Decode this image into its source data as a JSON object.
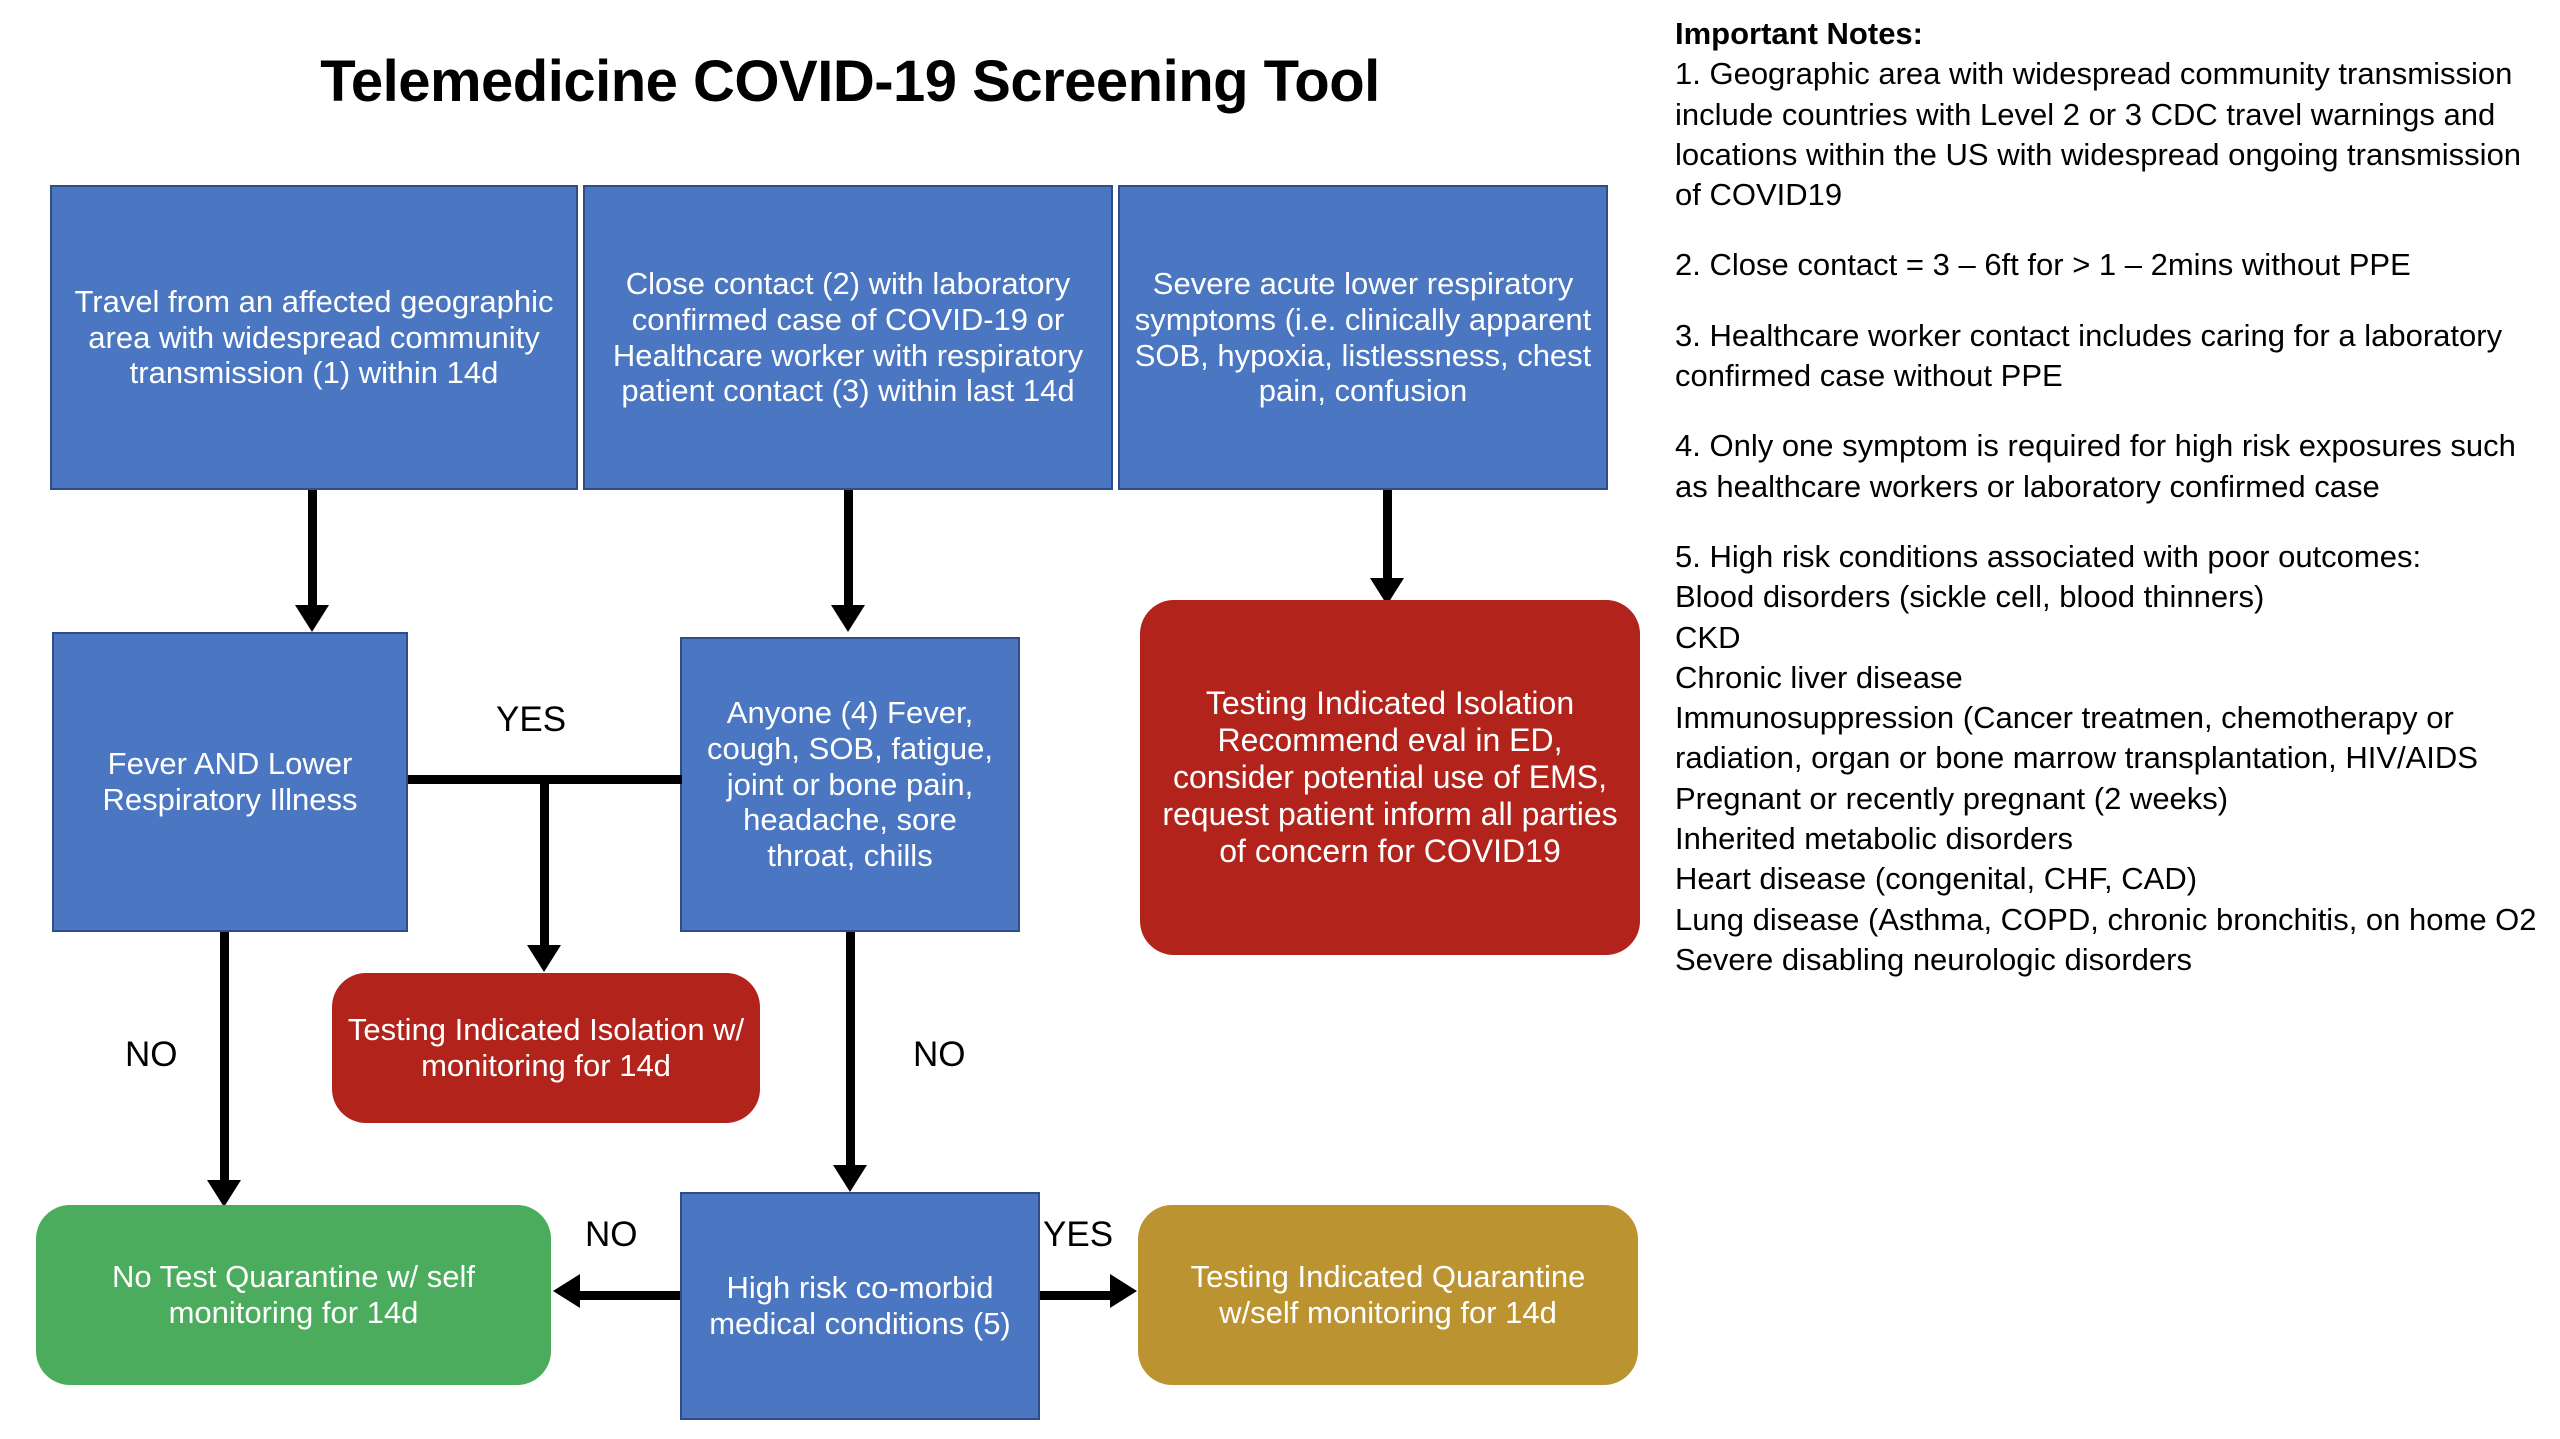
{
  "title": "Telemedicine COVID-19 Screening Tool",
  "colors": {
    "blue": "#4A76C2",
    "blue_border": "#2F4E86",
    "red": "#B2231C",
    "green": "#4CAC5D",
    "gold": "#BC9331",
    "text_on_fill": "#FFFFFF",
    "connector": "#000000",
    "background": "#FFFFFF"
  },
  "flowchart": {
    "nodes": {
      "travel": {
        "text": "Travel from an affected geographic area with widespread community transmission (1) within 14d",
        "fill": "blue",
        "shape": "rectangle"
      },
      "close_contact": {
        "text": "Close contact (2) with laboratory confirmed case of COVID-19 or Healthcare worker with respiratory patient contact (3) within last 14d",
        "fill": "blue",
        "shape": "rectangle"
      },
      "severe_symptoms": {
        "text": "Severe acute lower respiratory symptoms (i.e. clinically apparent SOB, hypoxia, listlessness, chest pain, confusion",
        "fill": "blue",
        "shape": "rectangle"
      },
      "fever_lri": {
        "text": "Fever AND Lower Respiratory Illness",
        "fill": "blue",
        "shape": "rectangle"
      },
      "anyone": {
        "text": "Anyone (4) Fever, cough, SOB, fatigue, joint or bone pain, headache, sore throat, chills",
        "fill": "blue",
        "shape": "rectangle"
      },
      "testing_ed": {
        "text": "Testing Indicated Isolation Recommend eval in ED, consider potential use of EMS, request patient inform all parties of concern for COVID19",
        "fill": "red",
        "shape": "rounded"
      },
      "testing_isolation": {
        "text": "Testing Indicated Isolation w/ monitoring for 14d",
        "fill": "red",
        "shape": "rounded"
      },
      "no_test": {
        "text": "No Test Quarantine w/ self monitoring for 14d",
        "fill": "green",
        "shape": "rounded"
      },
      "high_risk": {
        "text": "High risk co-morbid medical conditions (5)",
        "fill": "blue",
        "shape": "rectangle"
      },
      "testing_quarantine": {
        "text": "Testing Indicated Quarantine w/self monitoring for 14d",
        "fill": "gold",
        "shape": "rounded"
      }
    },
    "edge_labels": {
      "yes_fever_to_anyone": "YES",
      "no_fever_down": "NO",
      "no_anyone_down": "NO",
      "no_highrisk_left": "NO",
      "yes_highrisk_right": "YES"
    }
  },
  "notes": {
    "heading": "Important Notes:",
    "items": [
      "1. Geographic area with widespread community transmission include countries with Level 2 or 3 CDC travel warnings and locations within the US with widespread ongoing transmission of COVID19",
      "2. Close contact = 3 – 6ft for > 1 – 2mins without PPE",
      "3. Healthcare worker contact includes caring for a laboratory confirmed case without PPE",
      "4. Only one symptom is required for high risk exposures such as healthcare workers or laboratory confirmed case"
    ],
    "note5_heading": "5. High risk conditions associated with poor outcomes:",
    "note5_conditions": [
      "Blood disorders (sickle cell, blood thinners)",
      "CKD",
      "Chronic liver disease",
      "Immunosuppression (Cancer treatmen, chemotherapy or radiation, organ or bone marrow transplantation, HIV/AIDS",
      "Pregnant or recently pregnant (2 weeks)",
      "Inherited metabolic disorders",
      "Heart disease (congenital, CHF, CAD)",
      "Lung disease (Asthma, COPD, chronic bronchitis, on home O2",
      "Severe disabling neurologic disorders"
    ]
  }
}
